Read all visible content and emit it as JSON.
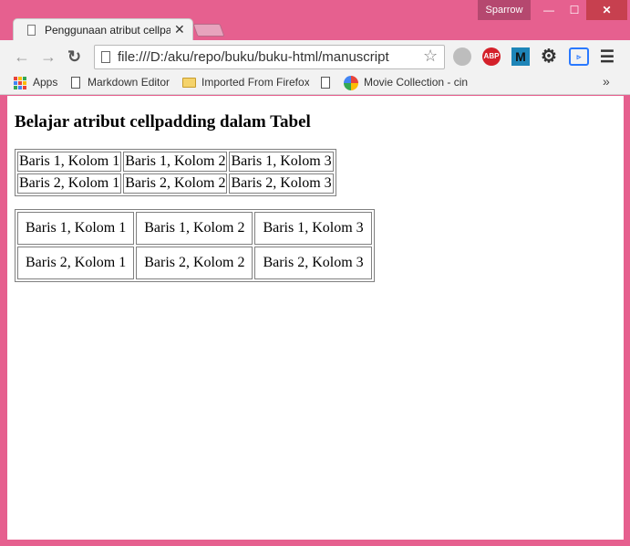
{
  "browser": {
    "profile_name": "Sparrow",
    "tab_title": "Penggunaan atribut cellpa",
    "url": "file:///D:/aku/repo/buku/buku-html/manuscript",
    "extensions": {
      "abp": "ABP",
      "m": "M"
    },
    "bookmarks": [
      "Apps",
      "Markdown Editor",
      "Imported From Firefox",
      "Movie Collection - cin"
    ]
  },
  "page": {
    "heading": "Belajar atribut cellpadding dalam Tabel",
    "table1": {
      "rows": [
        [
          "Baris 1, Kolom 1",
          "Baris 1, Kolom 2",
          "Baris 1, Kolom 3"
        ],
        [
          "Baris 2, Kolom 1",
          "Baris 2, Kolom 2",
          "Baris 2, Kolom 3"
        ]
      ]
    },
    "table2": {
      "rows": [
        [
          "Baris 1, Kolom 1",
          "Baris 1, Kolom 2",
          "Baris 1, Kolom 3"
        ],
        [
          "Baris 2, Kolom 1",
          "Baris 2, Kolom 2",
          "Baris 2, Kolom 3"
        ]
      ]
    }
  },
  "colors": {
    "frame": "#e6608f",
    "close": "#c7404f"
  }
}
